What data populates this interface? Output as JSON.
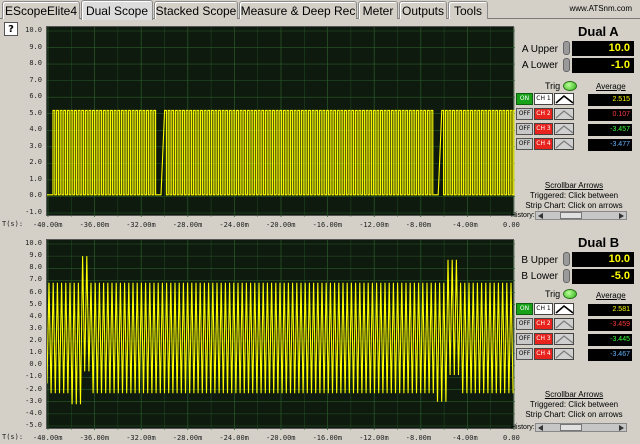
{
  "tabs": [
    {
      "label": "EScopeElite4",
      "active": false
    },
    {
      "label": "Dual Scope",
      "active": true
    },
    {
      "label": "Stacked Scope",
      "active": false
    },
    {
      "label": "Measure & Deep Rec",
      "active": false
    },
    {
      "label": "Meter",
      "active": false
    },
    {
      "label": "Outputs",
      "active": false
    },
    {
      "label": "Tools",
      "active": false
    }
  ],
  "site": "www.ATSnm.com",
  "help_label": "?",
  "x_axis": {
    "prefix": "T(s):",
    "ticks": [
      "-40.00m",
      "-36.00m",
      "-32.00m",
      "-28.00m",
      "-24.00m",
      "-20.00m",
      "-16.00m",
      "-12.00m",
      "-8.00m",
      "-4.00m",
      "0.00"
    ]
  },
  "scopes": [
    {
      "title": "Dual A",
      "upper_label": "A Upper",
      "upper_value": "10.0",
      "lower_label": "A Lower",
      "lower_value": "-1.0",
      "y_ticks": [
        "10.0",
        "9.0",
        "8.0",
        "7.0",
        "6.0",
        "5.0",
        "4.0",
        "3.0",
        "2.0",
        "1.0",
        "0.0",
        "-1.0"
      ],
      "trig_label": "Trig",
      "average_label": "Average",
      "channels": [
        {
          "state": "ON",
          "name": "CH 1",
          "avg": "2.515",
          "color": "#ffff00",
          "bg": "#ffffff"
        },
        {
          "state": "OFF",
          "name": "CH 2",
          "avg": "0.107",
          "color": "#ff3a3a",
          "bg": "#e8221c"
        },
        {
          "state": "OFF",
          "name": "CH 3",
          "avg": "-3.457",
          "color": "#3cff3c",
          "bg": "#e8221c"
        },
        {
          "state": "OFF",
          "name": "CH 4",
          "avg": "-3.477",
          "color": "#5fb4ff",
          "bg": "#e8221c"
        }
      ],
      "scrollbar_title": "Scrollbar Arrows",
      "scroll_line1": "Triggered: Click between",
      "scroll_line2": "Strip Chart: Click on arrows",
      "history_label": "History:"
    },
    {
      "title": "Dual B",
      "upper_label": "B Upper",
      "upper_value": "10.0",
      "lower_label": "B Lower",
      "lower_value": "-5.0",
      "y_ticks": [
        "10.0",
        "9.0",
        "8.0",
        "7.0",
        "6.0",
        "5.0",
        "4.0",
        "3.0",
        "2.0",
        "1.0",
        "0.0",
        "-1.0",
        "-2.0",
        "-3.0",
        "-4.0",
        "-5.0"
      ],
      "trig_label": "Trig",
      "average_label": "Average",
      "channels": [
        {
          "state": "ON",
          "name": "CH 1",
          "avg": "2.581",
          "color": "#ffff00",
          "bg": "#ffffff"
        },
        {
          "state": "OFF",
          "name": "CH 2",
          "avg": "-3.459",
          "color": "#ff3a3a",
          "bg": "#e8221c"
        },
        {
          "state": "OFF",
          "name": "CH 3",
          "avg": "-3.445",
          "color": "#3cff3c",
          "bg": "#e8221c"
        },
        {
          "state": "OFF",
          "name": "CH 4",
          "avg": "-3.467",
          "color": "#5fb4ff",
          "bg": "#e8221c"
        }
      ],
      "scrollbar_title": "Scrollbar Arrows",
      "scroll_line1": "Triggered: Click between",
      "scroll_line2": "Strip Chart: Click on arrows",
      "history_label": "History:"
    }
  ],
  "colors": {
    "trace": "#ffff00",
    "grid": "#2a5a2a",
    "plot_bg": "#0e1a0e",
    "accent_on": "#18a21a"
  }
}
